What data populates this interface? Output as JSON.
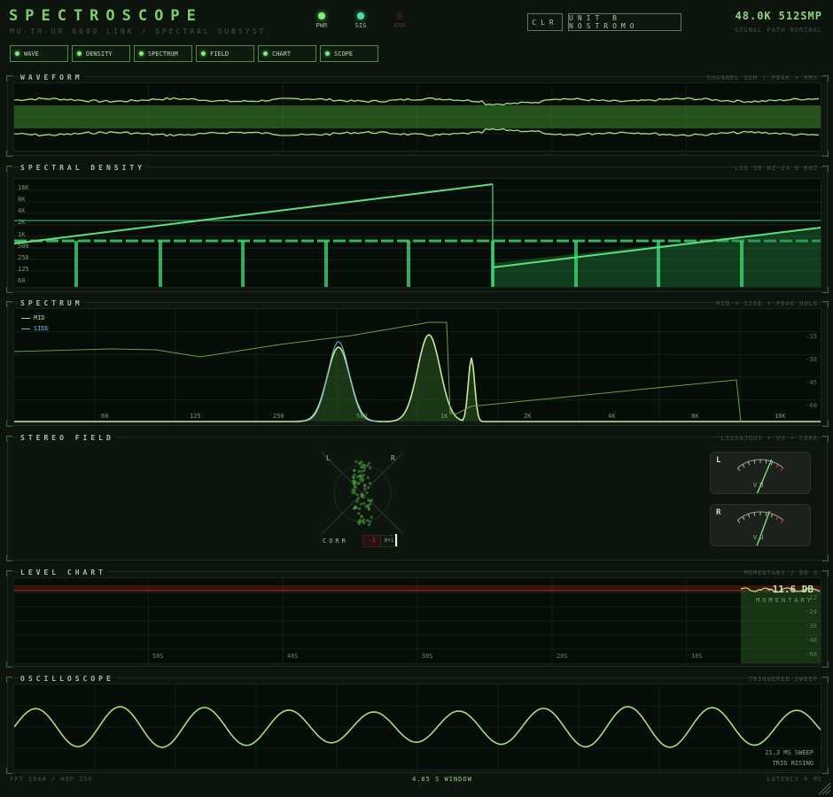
{
  "header": {
    "brand": "SPECTROSCOPE",
    "subtitle": "MU-TH-UR 6000 LINK / SPECTRAL SUBSYST_",
    "leds": [
      {
        "label": "PWR",
        "state": "on"
      },
      {
        "label": "SIG",
        "state": "on"
      },
      {
        "label": "ERR",
        "state": "off"
      }
    ],
    "clear_label": "CLR",
    "unit_label": "UNIT B NOSTROMO",
    "sample_rate": "48.0K",
    "buffer": "512SMP",
    "signal_note": "SIGNAL PATH NOMINAL"
  },
  "tabs": [
    "WAVE",
    "DENSITY",
    "SPECTRUM",
    "FIELD",
    "CHART",
    "SCOPE"
  ],
  "panels": {
    "waveform": {
      "title": "WAVEFORM",
      "note": "CHANNEL SUM / PEAK + RMS"
    },
    "density": {
      "title": "SPECTRAL DENSITY",
      "note": "LOG 30 HZ-24.0 KHZ",
      "freq_labels": [
        "16K",
        "8K",
        "4K",
        "2K",
        "1K",
        "500",
        "250",
        "125",
        "60"
      ]
    },
    "spectrum": {
      "title": "SPECTRUM",
      "note": "MID + SIDE + PEAK HOLD",
      "legend": [
        "MID",
        "SIDE"
      ],
      "x_labels": [
        "60",
        "125",
        "250",
        "500",
        "1K",
        "2K",
        "4K",
        "8K",
        "16K"
      ],
      "y_labels": [
        "-15",
        "-30",
        "-45",
        "-60"
      ]
    },
    "field": {
      "title": "STEREO FIELD",
      "note": "LISSAJOUS + VU + CORR",
      "left_label": "L",
      "right_label": "R",
      "corr_label": "CORR",
      "corr_min": "-1",
      "corr_max": "0+1",
      "meter_left": {
        "channel": "L",
        "caption": "VU",
        "level": 0.72
      },
      "meter_right": {
        "channel": "R",
        "caption": "VU",
        "level": 0.68
      }
    },
    "chart": {
      "title": "LEVEL CHART",
      "note": "MOMENTARY / 60 S",
      "readout": "-11.6 DB",
      "readout_caption": "MOMENTARY",
      "x_labels": [
        "50S",
        "40S",
        "30S",
        "20S",
        "10S"
      ],
      "y_labels": [
        "-12",
        "-24",
        "-36",
        "-48",
        "-60"
      ]
    },
    "scope": {
      "title": "OSCILLOSCOPE",
      "note": "TRIGGERED SWEEP",
      "sweep": "21.3 MS SWEEP",
      "trigger": "TRIG RISING"
    }
  },
  "footer": {
    "fft": "FFT 2048 / HOP 256",
    "window": "4.85 S WINDOW",
    "latency": "LATENCY 0 MS"
  },
  "colors": {
    "accent": "#7fcf6a",
    "trace": "#9be07a",
    "mint": "#4ee0a0",
    "bg": "#0c140d"
  }
}
